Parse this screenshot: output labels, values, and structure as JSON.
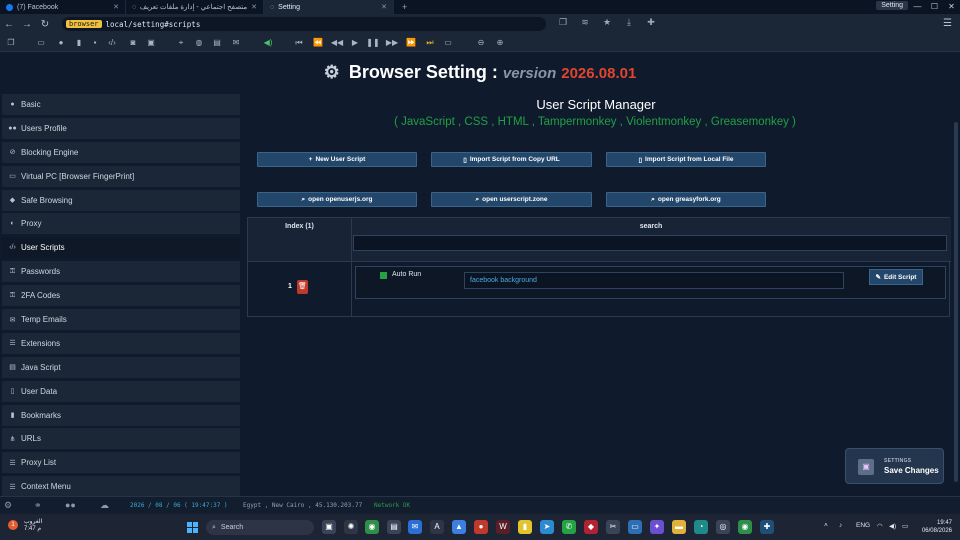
{
  "tabs": [
    {
      "label": "(7) Facebook",
      "active": false
    },
    {
      "label": "متصفح اجتماعي - إدارة ملفات تعريف م",
      "active": false
    },
    {
      "label": "Setting",
      "active": true
    }
  ],
  "window": {
    "badge": "Setting",
    "minimize": "—",
    "maximize": "☐",
    "close": "✕"
  },
  "address": {
    "chip": "browser",
    "url": "local/setting#scripts"
  },
  "page": {
    "title": "Browser Setting :",
    "version_label": "version",
    "version": "2026.08.01"
  },
  "sidebar": {
    "items": [
      {
        "label": "Basic",
        "icon": "info-icon"
      },
      {
        "label": "Users Profile",
        "icon": "users-icon"
      },
      {
        "label": "Blocking Engine",
        "icon": "block-icon"
      },
      {
        "label": "Virtual PC [Browser FingerPrint]",
        "icon": "monitor-icon"
      },
      {
        "label": "Safe Browsing",
        "icon": "shield-icon"
      },
      {
        "label": "Proxy",
        "icon": "proxy-icon"
      },
      {
        "label": "User Scripts",
        "icon": "code-icon",
        "active": true
      },
      {
        "label": "Passwords",
        "icon": "key-icon"
      },
      {
        "label": "2FA Codes",
        "icon": "key-icon"
      },
      {
        "label": "Temp Emails",
        "icon": "mail-icon"
      },
      {
        "label": "Extensions",
        "icon": "list-icon"
      },
      {
        "label": "Java Script",
        "icon": "script-icon"
      },
      {
        "label": "User Data",
        "icon": "file-icon"
      },
      {
        "label": "Bookmarks",
        "icon": "bookmark-icon"
      },
      {
        "label": "URLs",
        "icon": "sitemap-icon"
      },
      {
        "label": "Proxy List",
        "icon": "list-icon"
      },
      {
        "label": "Context Menu",
        "icon": "list-icon"
      }
    ]
  },
  "script_manager": {
    "title": "User Script Manager",
    "subtitle": "( JavaScript , CSS , HTML , Tampermonkey , Violentmonkey , Greasemonkey )",
    "buttons": {
      "new_script": "New User Script",
      "import_url": "Import Script from Copy URL",
      "import_file": "Import Script from Local File",
      "openuserjs": "open openuserjs.org",
      "userscript_zone": "open userscript.zone",
      "greasyfork": "open greasyfork.org"
    },
    "table": {
      "index_header": "Index (1)",
      "search_header": "search",
      "search_value": "",
      "rows": [
        {
          "index": "1",
          "auto_run_label": "Auto Run",
          "auto_run": true,
          "name": "facebook background",
          "edit_label": "Edit Script"
        }
      ]
    }
  },
  "save_card": {
    "small": "SETTINGS",
    "big": "Save Changes"
  },
  "status": {
    "date": "2026 / 08 / 06 ( 19:47:37 )",
    "location": "Egypt , New Cairo , 45.130.203.77",
    "network": "Network OK",
    "colors": {
      "date": "#3da9d8",
      "location": "#8ea2b6",
      "network": "#2f9a4e"
    }
  },
  "taskbar": {
    "weather_label": "الغروب",
    "weather_time": "7:47 م",
    "notif_count": "1",
    "search_placeholder": "Search",
    "lang": "ENG",
    "time": "19:47",
    "date": "06/08/2026"
  }
}
